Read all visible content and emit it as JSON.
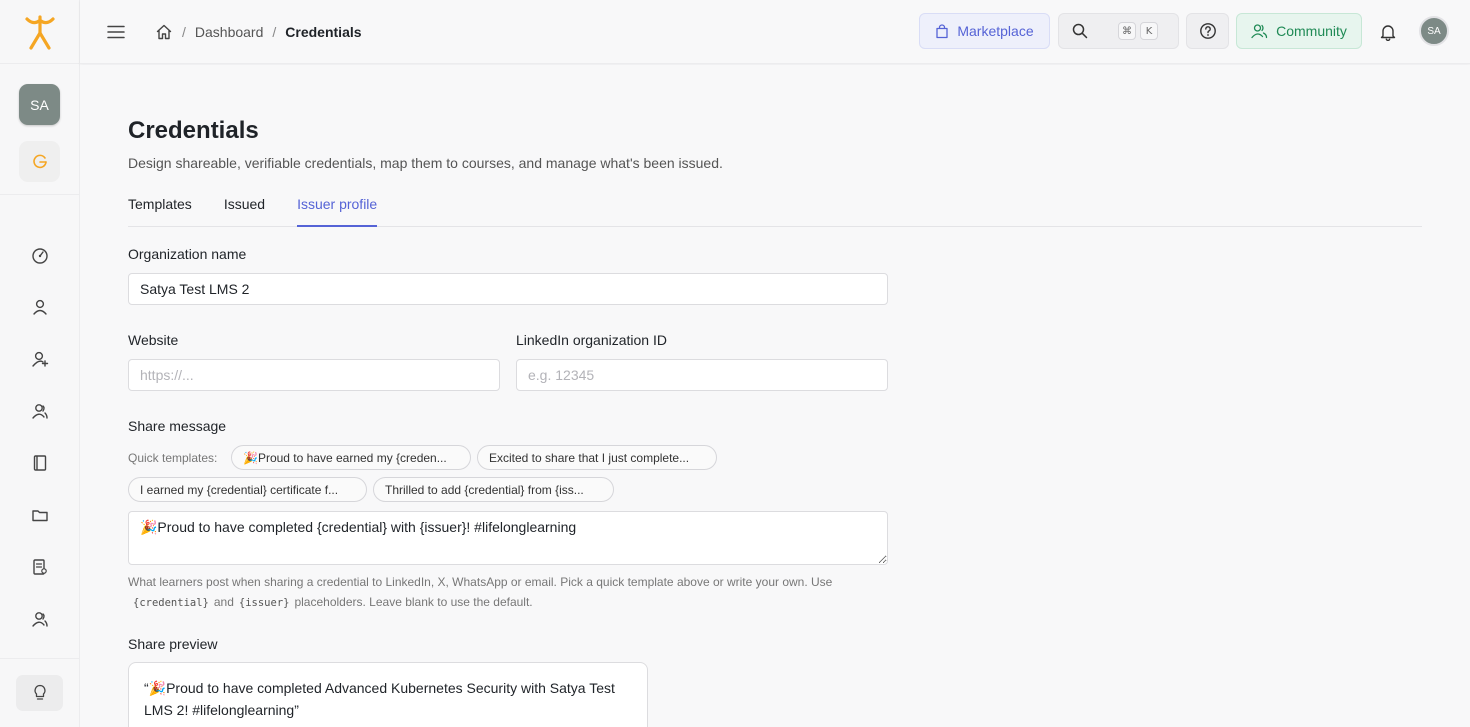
{
  "header": {
    "breadcrumb": {
      "dashboard": "Dashboard",
      "current": "Credentials"
    },
    "marketplace_label": "Marketplace",
    "search_kbd_1": "⌘",
    "search_kbd_2": "K",
    "community_label": "Community",
    "user_initials": "SA"
  },
  "sidebar": {
    "workspace_initials": "SA",
    "items": [
      {
        "name": "dashboard-icon"
      },
      {
        "name": "user-icon"
      },
      {
        "name": "user-add-icon"
      },
      {
        "name": "users-icon"
      },
      {
        "name": "book-icon"
      },
      {
        "name": "folder-icon"
      },
      {
        "name": "report-icon"
      },
      {
        "name": "groups-icon"
      }
    ]
  },
  "page": {
    "title": "Credentials",
    "subtitle": "Design shareable, verifiable credentials, map them to courses, and manage what's been issued.",
    "tabs": [
      "Templates",
      "Issued",
      "Issuer profile"
    ],
    "active_tab": "Issuer profile"
  },
  "form": {
    "org_name_label": "Organization name",
    "org_name_value": "Satya Test LMS 2",
    "website_label": "Website",
    "website_placeholder": "https://...",
    "linkedin_label": "LinkedIn organization ID",
    "linkedin_placeholder": "e.g. 12345",
    "share_message_label": "Share message",
    "quick_templates_label": "Quick templates:",
    "quick_templates": [
      "🎉Proud to have earned my {creden...",
      "Excited to share that I just complete...",
      "I earned my {credential} certificate f...",
      "Thrilled to add {credential} from {iss..."
    ],
    "share_message_value": "🎉Proud to have completed {credential} with {issuer}! #lifelonglearning",
    "hint_before": "What learners post when sharing a credential to LinkedIn, X, WhatsApp or email. Pick a quick template above or write your own. Use",
    "hint_code_1": "{credential}",
    "hint_and": "and",
    "hint_code_2": "{issuer}",
    "hint_after": "placeholders. Leave blank to use the default.",
    "share_preview_label": "Share preview",
    "share_preview_text": "“🎉Proud to have completed Advanced Kubernetes Security with Satya Test LMS 2! #lifelonglearning”"
  },
  "colors": {
    "accent": "#5563d6",
    "logo": "#f5a623",
    "community": "#1f8a55"
  }
}
